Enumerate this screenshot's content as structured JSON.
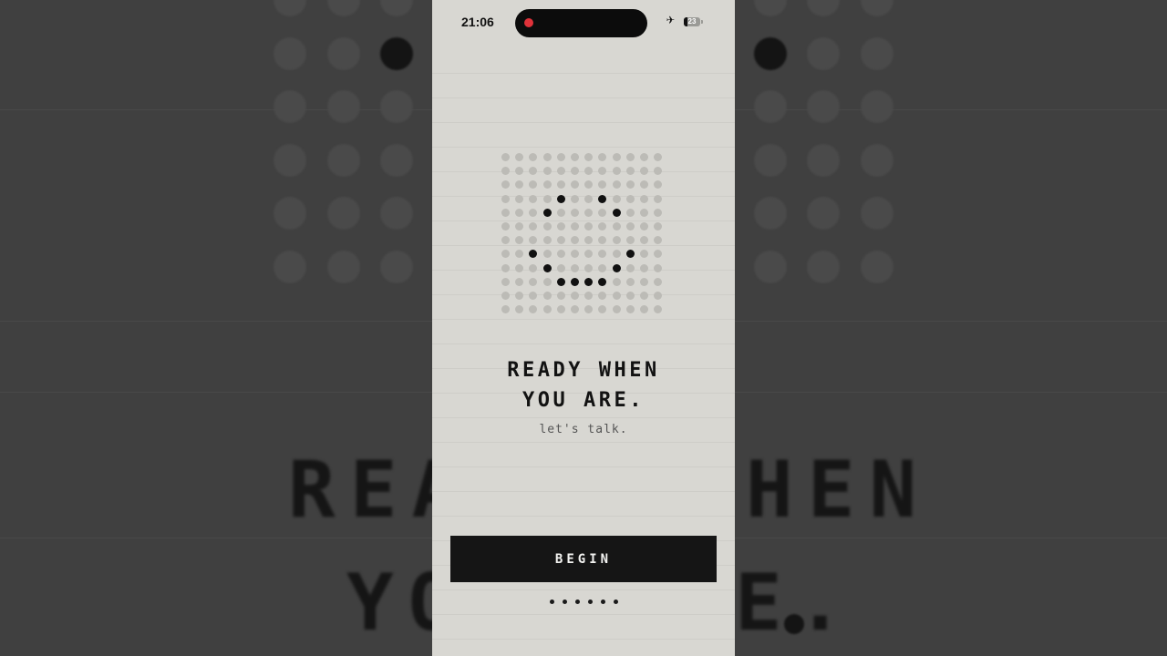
{
  "status_bar": {
    "time": "21:06",
    "recording_indicator_color": "#e0323a",
    "airplane_icon": "airplane-icon",
    "battery_level": "23",
    "battery_fraction": 0.23
  },
  "face_grid": {
    "rows": 12,
    "cols": 12,
    "on_color": "#111111",
    "off_color": "#bcbbb6",
    "active_cells": [
      [
        3,
        4
      ],
      [
        3,
        7
      ],
      [
        4,
        3
      ],
      [
        4,
        8
      ],
      [
        7,
        2
      ],
      [
        7,
        9
      ],
      [
        8,
        3
      ],
      [
        8,
        8
      ],
      [
        9,
        4
      ],
      [
        9,
        5
      ],
      [
        9,
        6
      ],
      [
        9,
        7
      ]
    ]
  },
  "headline": {
    "line1": "READY WHEN",
    "line2": "YOU ARE."
  },
  "subtitle": "let's talk.",
  "begin_button": {
    "label": "BEGIN"
  },
  "pager": {
    "count": 6
  },
  "background": {
    "mirrored_text_line1": "REA",
    "mirrored_text_line1b": "HEN",
    "mirrored_text_line2": "YO",
    "mirrored_text_line2b": "E."
  },
  "colors": {
    "screen_background": "#d8d7d2",
    "button_background": "#151515",
    "text_primary": "#121212"
  }
}
